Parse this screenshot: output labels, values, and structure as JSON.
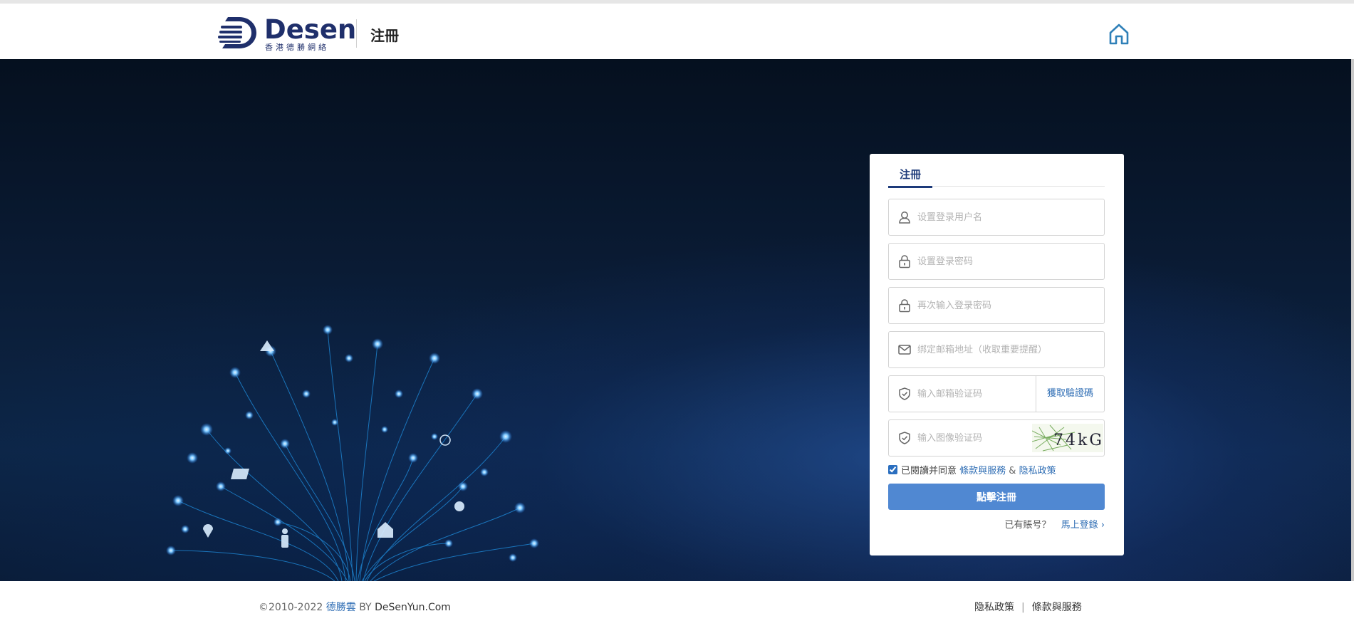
{
  "header": {
    "logo_word": "Desen",
    "logo_sub": "香港德勝網絡",
    "title": "注冊"
  },
  "register": {
    "tab_label": "注冊",
    "username_placeholder": "设置登录用户名",
    "password_placeholder": "设置登录密码",
    "password_confirm_placeholder": "再次输入登录密码",
    "email_placeholder": "绑定邮箱地址（收取重要提醒）",
    "email_code_placeholder": "输入邮箱验证码",
    "get_code_label": "獲取驗證碼",
    "image_code_placeholder": "输入图像验证码",
    "captcha_text": "74kG",
    "agree_checked": true,
    "agree_prefix": "已閱讀并同意 ",
    "terms_link": "條款與服務",
    "amp": " & ",
    "privacy_link": "隐私政策",
    "submit_label": "點擊注冊",
    "has_account": "已有賬号？",
    "login_link": "馬上登錄 ›"
  },
  "footer": {
    "copyright_prefix": "©2010-2022 ",
    "brand": "德勝雲",
    "by": " BY ",
    "domain": "DeSenYun.Com",
    "privacy": "隐私政策",
    "separator": "|",
    "terms": "條款與服務"
  },
  "icons": {
    "home": "home-icon",
    "user": "user-icon",
    "lock": "lock-icon",
    "mail": "mail-icon",
    "shield": "shield-icon"
  },
  "colors": {
    "brand_navy": "#1f2f6b",
    "link_blue": "#2e6db4",
    "button_blue": "#5088d2",
    "home_icon": "#2f80b8"
  }
}
